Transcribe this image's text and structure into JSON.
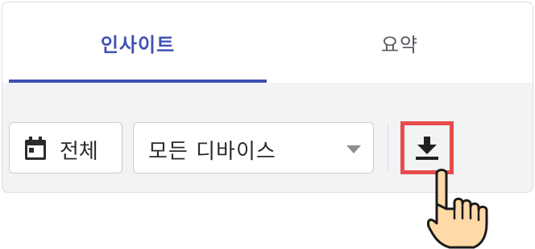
{
  "tabs": [
    {
      "label": "인사이트",
      "active": true
    },
    {
      "label": "요약",
      "active": false
    }
  ],
  "toolbar": {
    "date_label": "전체",
    "date_icon": "calendar-icon",
    "device_value": "모든 디바이스",
    "device_chevron_icon": "triangle-down-icon",
    "download_icon": "download-icon"
  },
  "colors": {
    "accent": "#3f51b5",
    "highlight": "#e74c4c"
  }
}
